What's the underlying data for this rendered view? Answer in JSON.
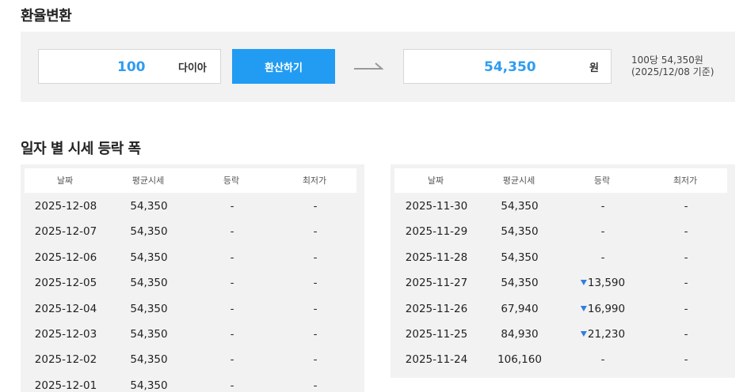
{
  "converter": {
    "title": "환율변환",
    "input_value": "100",
    "input_unit": "다이아",
    "convert_label": "환산하기",
    "output_value": "54,350",
    "output_unit": "원",
    "rate_note_line1": "100당 54,350원",
    "rate_note_line2": "(2025/12/08 기준)",
    "accent_color": "#229cf2"
  },
  "history": {
    "title": "일자 별 시세 등락 폭",
    "headers": [
      "날짜",
      "평균시세",
      "등락",
      "최저가"
    ],
    "left_rows": [
      {
        "date": "2025-12-08",
        "avg": "54,350",
        "change": "-",
        "low": "-"
      },
      {
        "date": "2025-12-07",
        "avg": "54,350",
        "change": "-",
        "low": "-"
      },
      {
        "date": "2025-12-06",
        "avg": "54,350",
        "change": "-",
        "low": "-"
      },
      {
        "date": "2025-12-05",
        "avg": "54,350",
        "change": "-",
        "low": "-"
      },
      {
        "date": "2025-12-04",
        "avg": "54,350",
        "change": "-",
        "low": "-"
      },
      {
        "date": "2025-12-03",
        "avg": "54,350",
        "change": "-",
        "low": "-"
      },
      {
        "date": "2025-12-02",
        "avg": "54,350",
        "change": "-",
        "low": "-"
      },
      {
        "date": "2025-12-01",
        "avg": "54,350",
        "change": "-",
        "low": "-"
      }
    ],
    "right_rows": [
      {
        "date": "2025-11-30",
        "avg": "54,350",
        "change": "-",
        "low": "-"
      },
      {
        "date": "2025-11-29",
        "avg": "54,350",
        "change": "-",
        "low": "-"
      },
      {
        "date": "2025-11-28",
        "avg": "54,350",
        "change": "-",
        "low": "-"
      },
      {
        "date": "2025-11-27",
        "avg": "54,350",
        "change": "13,590",
        "down": true,
        "low": "-"
      },
      {
        "date": "2025-11-26",
        "avg": "67,940",
        "change": "16,990",
        "down": true,
        "low": "-"
      },
      {
        "date": "2025-11-25",
        "avg": "84,930",
        "change": "21,230",
        "down": true,
        "low": "-"
      },
      {
        "date": "2025-11-24",
        "avg": "106,160",
        "change": "-",
        "low": "-"
      }
    ],
    "down_color": "#2f7fe0"
  }
}
